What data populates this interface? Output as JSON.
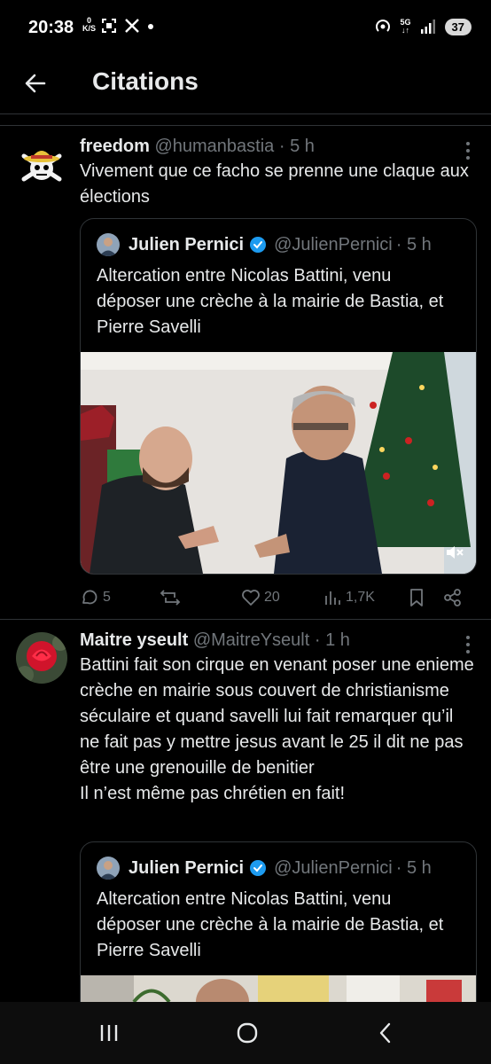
{
  "status_bar": {
    "time": "20:38",
    "speed_value": "0",
    "speed_unit": "K/S",
    "network": "5G",
    "battery": "37"
  },
  "header": {
    "title": "Citations"
  },
  "posts": [
    {
      "name": "freedom",
      "handle": "@humanbastia",
      "time": "· 5 h",
      "text": "Vivement que ce facho se prenne une claque aux élections",
      "quote": {
        "name": "Julien Pernici",
        "handle": "@JulienPernici",
        "time": "· 5 h",
        "text": "Altercation entre Nicolas Battini, venu déposer une crèche à la mairie de Bastia, et Pierre Savelli"
      },
      "actions": {
        "replies": "5",
        "likes": "20",
        "views": "1,7K"
      }
    },
    {
      "name": "Maitre yseult",
      "handle": "@MaitreYseult",
      "time": "· 1 h",
      "text": "Battini fait son cirque en venant poser une enieme crèche en mairie sous couvert de christianisme séculaire et quand savelli lui fait remarquer qu’il ne fait pas y mettre jesus avant le 25 il dit ne pas être une grenouille de benitier",
      "text2": "Il n’est même pas chrétien en fait!",
      "quote": {
        "name": "Julien Pernici",
        "handle": "@JulienPernici",
        "time": "· 5 h",
        "text": "Altercation entre Nicolas Battini, venu déposer une crèche à la mairie de Bastia, et Pierre Savelli"
      }
    }
  ],
  "colors": {
    "background": "#000000",
    "text": "#e7e9ea",
    "secondary": "#71767b",
    "border": "#2f3336",
    "verified": "#1d9bf0"
  }
}
